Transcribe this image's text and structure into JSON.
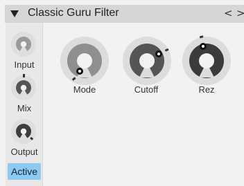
{
  "header": {
    "title": "Classic Guru Filter",
    "collapse_glyph": "▼",
    "prev_glyph": "<",
    "next_glyph": ">"
  },
  "knobs": {
    "input": {
      "label": "Input"
    },
    "mix": {
      "label": "Mix"
    },
    "output": {
      "label": "Output"
    },
    "mode": {
      "label": "Mode"
    },
    "cutoff": {
      "label": "Cutoff"
    },
    "rez": {
      "label": "Rez"
    }
  },
  "active_button": {
    "label": "Active"
  },
  "colors": {
    "panel": "#f2f2f2",
    "header": "#d6d6d6",
    "sidebar": "#e8e8e8",
    "ring_track": "#d6d6d6",
    "knob_body": "#555555",
    "indicator": "#111111",
    "active_accent": "#8ec9f2"
  }
}
